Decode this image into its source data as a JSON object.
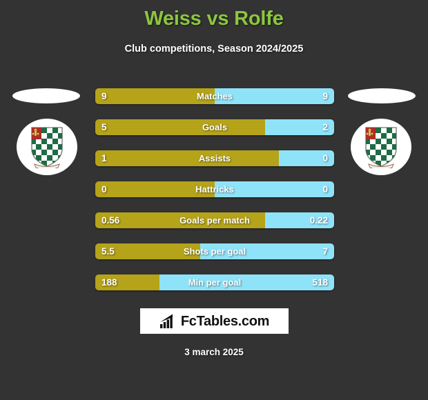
{
  "header": {
    "title": "Weiss vs Rolfe",
    "subtitle": "Club competitions, Season 2024/2025",
    "title_color": "#8CC63F"
  },
  "colors": {
    "background": "#333333",
    "home_bar": "#B5A319",
    "away_bar": "#8FE3F9",
    "text": "#FFFFFF"
  },
  "home": {
    "photo_name": "player-photo-weiss",
    "crest_name": "club-crest-weiss"
  },
  "away": {
    "photo_name": "player-photo-rolfe",
    "crest_name": "club-crest-rolfe"
  },
  "stats": [
    {
      "label": "Matches",
      "home": "9",
      "away": "9",
      "home_pct": 50
    },
    {
      "label": "Goals",
      "home": "5",
      "away": "2",
      "home_pct": 71
    },
    {
      "label": "Assists",
      "home": "1",
      "away": "0",
      "home_pct": 77
    },
    {
      "label": "Hattricks",
      "home": "0",
      "away": "0",
      "home_pct": 50
    },
    {
      "label": "Goals per match",
      "home": "0.56",
      "away": "0.22",
      "home_pct": 71
    },
    {
      "label": "Shots per goal",
      "home": "5.5",
      "away": "7",
      "home_pct": 44
    },
    {
      "label": "Min per goal",
      "home": "188",
      "away": "518",
      "home_pct": 27
    }
  ],
  "footer": {
    "logo_text": "FcTables.com",
    "date": "3 march 2025"
  }
}
